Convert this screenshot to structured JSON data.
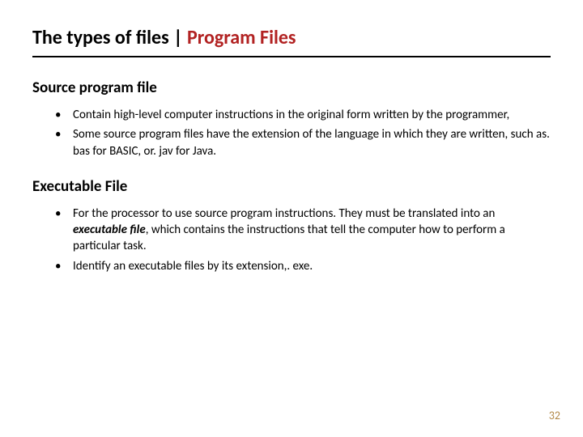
{
  "title": {
    "prefix": "The types of files | ",
    "accent": "Program Files"
  },
  "sections": [
    {
      "heading": "Source program file",
      "bullets": [
        {
          "text": "Contain high-level computer instructions in the original form written by the programmer,"
        },
        {
          "text": "Some source program files have the extension of the language in which they are written, such as. bas for BASIC, or. jav for Java."
        }
      ]
    },
    {
      "heading": "Executable File",
      "bullets": [
        {
          "pre": "For the processor to use source program instructions. They must be translated into an ",
          "em": "executable file",
          "post": ", which contains the instructions that tell the computer how to perform a particular task."
        },
        {
          "text": "Identify an executable files by its extension,. exe."
        }
      ]
    }
  ],
  "pageNumber": "32"
}
